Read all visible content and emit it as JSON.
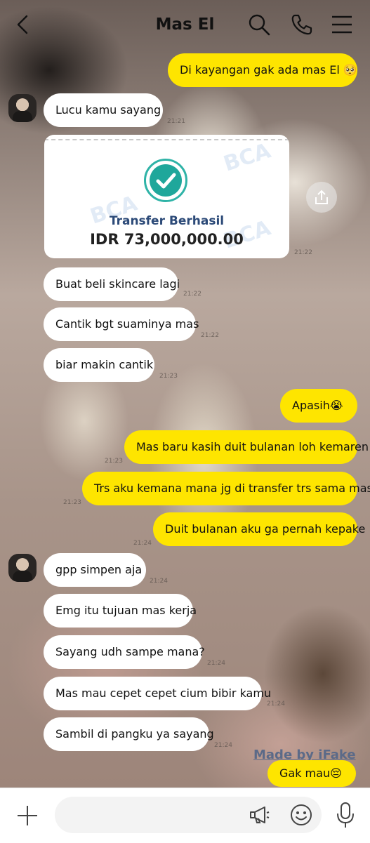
{
  "header": {
    "title": "Mas El",
    "icons": [
      "back-icon",
      "search-icon",
      "phone-icon",
      "menu-icon"
    ]
  },
  "messages": {
    "m1": "Di kayangan gak ada mas El 🥺",
    "m2": "Lucu kamu sayang",
    "m3": "Buat beli skincare lagi",
    "m4": "Cantik bgt suaminya mas",
    "m5": "biar makin cantik",
    "m6": "Apasih😭",
    "m7": "Mas baru kasih duit bulanan loh kemaren",
    "m8": "Trs aku kemana mana jg di transfer trs sama mas",
    "m9": "Duit bulanan aku ga pernah kepake",
    "m10": "gpp simpen aja",
    "m11": "Emg itu tujuan mas kerja",
    "m12": "Sayang udh sampe mana?",
    "m13": "Mas mau cepet cepet cium bibir kamu",
    "m14": "Sambil di pangku ya sayang",
    "m15": "Gak mau😔"
  },
  "times": {
    "t1": "21:21",
    "t2": "21:22",
    "t3": "21:22",
    "t4": "21:22",
    "t5": "21:23",
    "t6": "21:23",
    "t7": "21:23",
    "t8": "21:24",
    "t9": "21:24",
    "t10": "21:24",
    "t11": "21:24",
    "t12": "21:24"
  },
  "receipt": {
    "watermark": "BCA",
    "status": "Transfer Berhasil",
    "amount": "IDR 73,000,000.00"
  },
  "watermark_text": "Made by iFake",
  "colors": {
    "outgoing": "#fee500",
    "incoming": "#ffffff",
    "check": "#1fa79b",
    "receipt_label": "#2c4a78"
  }
}
